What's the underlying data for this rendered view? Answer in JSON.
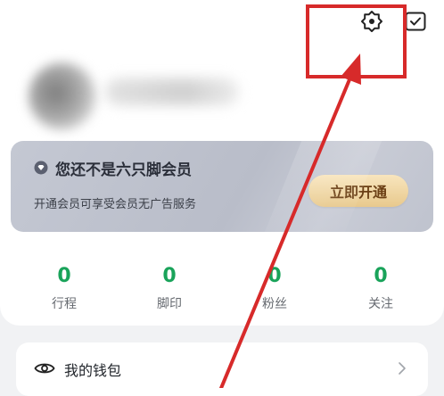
{
  "icons": {
    "settings": "settings-gear-icon",
    "checkin": "check-square-icon",
    "vip_badge": "diamond-icon",
    "wallet": "eye-icon",
    "chevron": "chevron-right-icon"
  },
  "membership": {
    "title": "您还不是六只脚会员",
    "description": "开通会员可享受会员无广告服务",
    "button_label": "立即开通"
  },
  "stats": [
    {
      "value": "0",
      "label": "行程"
    },
    {
      "value": "0",
      "label": "脚印"
    },
    {
      "value": "0",
      "label": "粉丝"
    },
    {
      "value": "0",
      "label": "关注"
    }
  ],
  "menu": {
    "wallet_label": "我的钱包"
  },
  "colors": {
    "accent_green": "#19a35a",
    "annotation_red": "#d72a2a",
    "vip_button_gold": "#e8c98d"
  }
}
